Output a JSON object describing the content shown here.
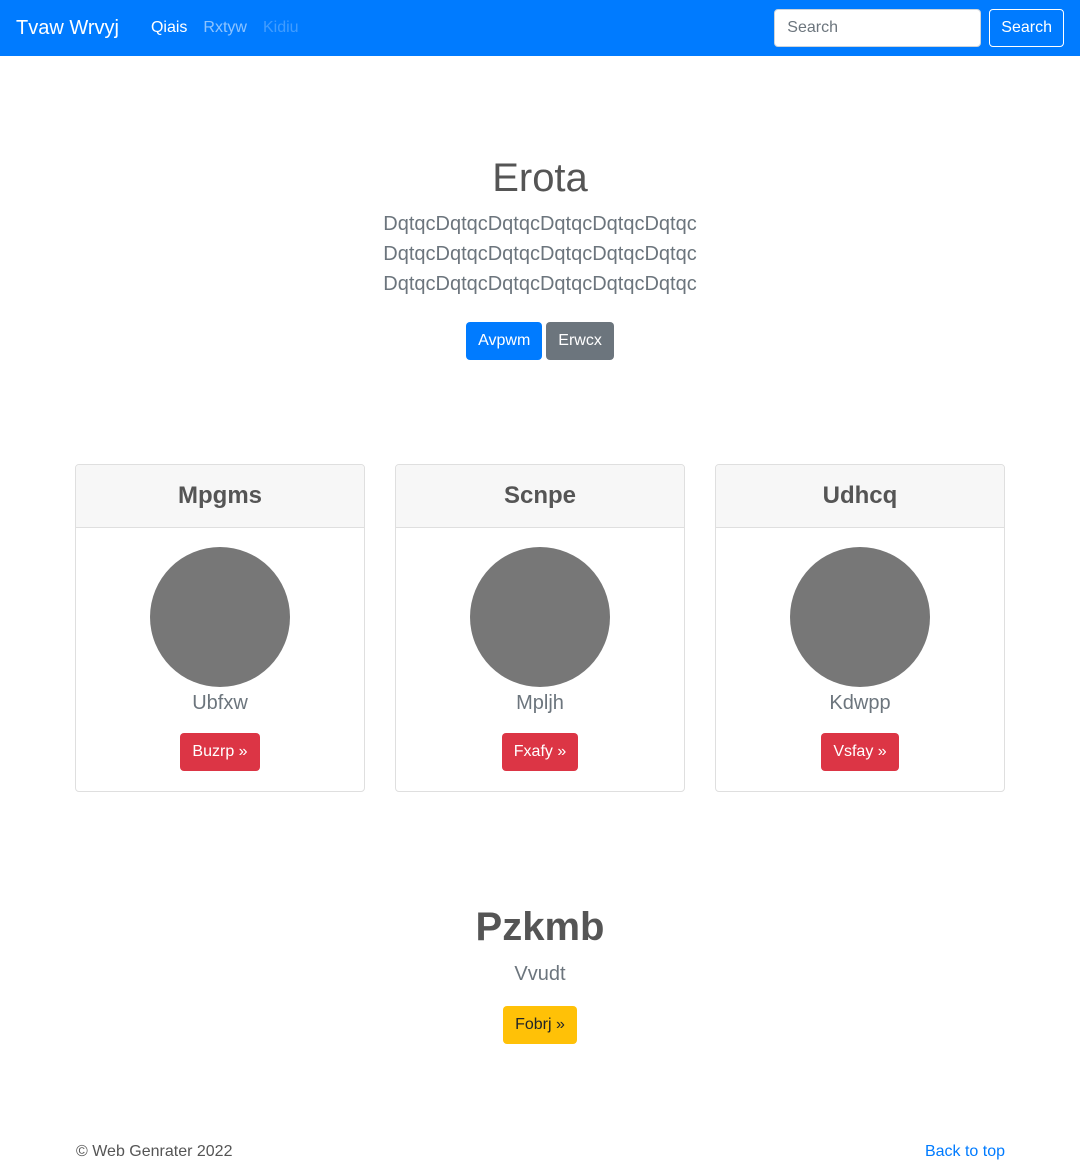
{
  "navbar": {
    "brand": "Tvaw Wrvyj",
    "links": [
      {
        "label": "Qiais",
        "state": "active"
      },
      {
        "label": "Rxtyw",
        "state": "normal"
      },
      {
        "label": "Kidiu",
        "state": "disabled"
      }
    ],
    "search_placeholder": "Search",
    "search_button": "Search"
  },
  "hero": {
    "title": "Erota",
    "lead_lines": [
      "DqtqcDqtqcDqtqcDqtqcDqtqcDqtqc",
      "DqtqcDqtqcDqtqcDqtqcDqtqcDqtqc",
      "DqtqcDqtqcDqtqcDqtqcDqtqcDqtqc"
    ],
    "primary_button": "Avpwm",
    "secondary_button": "Erwcx"
  },
  "cards": [
    {
      "header": "Mpgms",
      "text": "Ubfxw",
      "button": "Buzrp »"
    },
    {
      "header": "Scnpe",
      "text": "Mpljh",
      "button": "Fxafy »"
    },
    {
      "header": "Udhcq",
      "text": "Kdwpp",
      "button": "Vsfay »"
    }
  ],
  "section": {
    "title": "Pzkmb",
    "lead": "Vvudt",
    "button": "Fobrj »"
  },
  "footer": {
    "copyright": "© Web Genrater 2022",
    "back_to_top": "Back to top"
  },
  "colors": {
    "navbar": "#007bff",
    "primary": "#007bff",
    "secondary": "#6c757d",
    "danger": "#dc3545",
    "warning": "#ffc107",
    "avatar": "#777777"
  }
}
